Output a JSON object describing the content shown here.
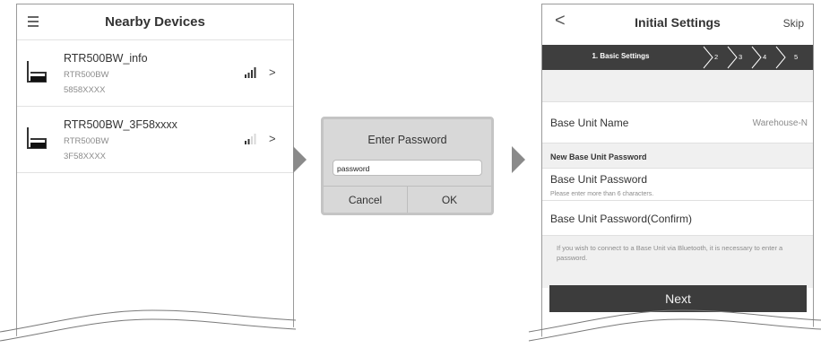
{
  "screen1": {
    "title": "Nearby Devices",
    "icons": {
      "menu": "hamburger-menu-icon",
      "device": "base-unit-device-icon",
      "signal": "signal-strength-icon",
      "chevron": "chevron-right-icon"
    },
    "devices": [
      {
        "name": "RTR500BW_info",
        "model": "RTR500BW",
        "serial": "5858XXXX",
        "signal_bars": 4,
        "chevron": ">"
      },
      {
        "name": "RTR500BW_3F58xxxx",
        "model": "RTR500BW",
        "serial": "3F58XXXX",
        "signal_bars": 2,
        "chevron": ">"
      }
    ]
  },
  "dialog": {
    "title": "Enter Password",
    "input_value": "password",
    "cancel_label": "Cancel",
    "ok_label": "OK"
  },
  "screen2": {
    "back_symbol": "<",
    "title": "Initial Settings",
    "skip_label": "Skip",
    "steps": [
      "1. Basic Settings",
      "2",
      "3",
      "4",
      "5"
    ],
    "base_unit_name_label": "Base Unit Name",
    "base_unit_name_value": "Warehouse-N",
    "section_title": "New Base Unit Password",
    "password_label": "Base Unit Password",
    "password_hint": "Please enter more than 6 characters.",
    "password_confirm_label": "Base Unit Password(Confirm)",
    "note": "If you wish to connect to a Base Unit via Bluetooth, it is necessary to enter a password.",
    "next_label": "Next"
  },
  "colors": {
    "dark_bar": "#3e3e3e",
    "panel_bg": "#f0f0f0",
    "dialog_bg": "#d8d8d8",
    "flow_arrow": "#8a8a8a"
  }
}
